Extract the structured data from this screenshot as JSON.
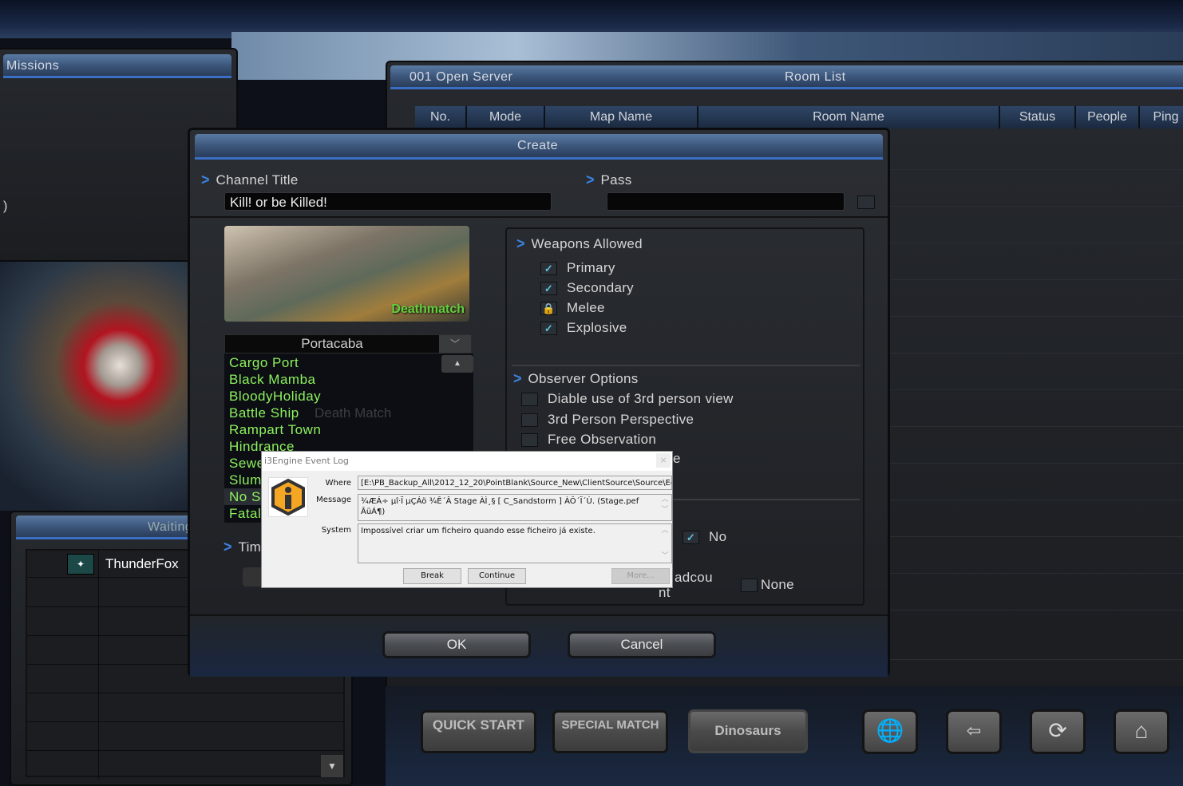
{
  "missions_panel": {
    "title": "Missions",
    "fragment": ")"
  },
  "room_list": {
    "server": "001 Open Server",
    "title": "Room List",
    "columns": [
      "No.",
      "Mode",
      "Map Name",
      "Room Name",
      "Status",
      "People",
      "Ping"
    ]
  },
  "create_dialog": {
    "title": "Create",
    "channel_title_label": "Channel Title",
    "channel_title_value": "Kill! or be Killed!",
    "pass_label": "Pass",
    "pass_value": "",
    "map_preview_mode": "Deathmatch",
    "map_select": "Portacaba",
    "map_list": [
      "Cargo Port",
      "Black Mamba",
      "BloodyHoliday",
      "Battle Ship",
      "Rampart Town",
      "Hindrance",
      "Sewe",
      "Slum",
      "No S",
      "Fatal"
    ],
    "mode_hidden_value": "Death Match",
    "time_label_partial": "Tim",
    "weapons": {
      "title": "Weapons Allowed",
      "items": [
        {
          "label": "Primary",
          "state": "checked"
        },
        {
          "label": "Secondary",
          "state": "checked"
        },
        {
          "label": "Melee",
          "state": "locked"
        },
        {
          "label": "Explosive",
          "state": "checked"
        }
      ]
    },
    "observer": {
      "title": "Observer Options",
      "items": [
        {
          "label": "Diable use of 3rd person view",
          "checked": false
        },
        {
          "label": "3rd Person Perspective",
          "checked": false
        },
        {
          "label": "Free Observation",
          "checked": false
        }
      ],
      "partial": "e"
    },
    "lower": {
      "no_label": "No",
      "broadcount_partial_1": "adcou",
      "broadcount_partial_2": "nt",
      "none_label": "None"
    },
    "ok": "OK",
    "cancel": "Cancel"
  },
  "waiting_list": {
    "title": "Waiting List",
    "players": [
      "ThunderFox"
    ]
  },
  "bottom_bar": {
    "quick_start": "QUICK START",
    "special_match": "SPECIAL MATCH",
    "dinosaurs": "Dinosaurs",
    "icons": [
      "globe-refresh-icon",
      "enter-room-icon",
      "refresh-icon",
      "create-room-icon"
    ]
  },
  "event_log": {
    "title": "i3Engine Event Log",
    "where_label": "Where",
    "where": "[E:\\PB_Backup_All\\2012_12_20\\PointBlank\\Source_New\\ClientSource\\Source\\Equ",
    "message_label": "Message",
    "message": "¾ÆÁ÷ µî·Ï µÇÁö ¾Ê´Â Stage ÀÌ¸§ [ C_Sandstorm ] ÀÔ´Ï´Ù. (Stage.pef ÂüÁ¶)",
    "system_label": "System",
    "system": "Impossível criar um ficheiro quando esse ficheiro já existe.",
    "break": "Break",
    "continue": "Continue",
    "more": "More...",
    "close": "×"
  },
  "colors": {
    "accent": "#3b82e0",
    "map_green": "#8df25c",
    "warning_icon": "#f5a623"
  }
}
